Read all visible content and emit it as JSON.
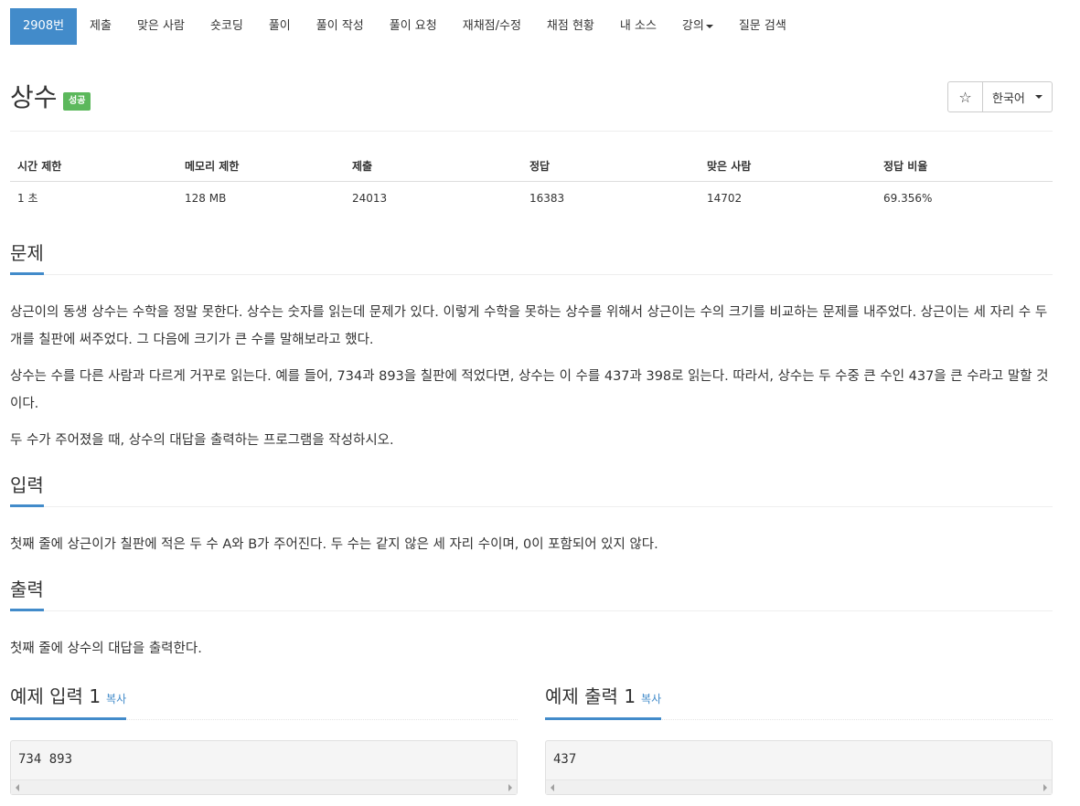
{
  "nav": {
    "items": [
      {
        "label": "2908번",
        "active": true
      },
      {
        "label": "제출"
      },
      {
        "label": "맞은 사람"
      },
      {
        "label": "숏코딩"
      },
      {
        "label": "풀이"
      },
      {
        "label": "풀이 작성"
      },
      {
        "label": "풀이 요청"
      },
      {
        "label": "재채점/수정"
      },
      {
        "label": "채점 현황"
      },
      {
        "label": "내 소스"
      },
      {
        "label": "강의",
        "dropdown": true
      },
      {
        "label": "질문 검색"
      }
    ]
  },
  "problem": {
    "title": "상수",
    "status_badge": "성공",
    "star_icon": "star-outline-icon",
    "language_label": "한국어"
  },
  "info_table": {
    "headers": [
      "시간 제한",
      "메모리 제한",
      "제출",
      "정답",
      "맞은 사람",
      "정답 비율"
    ],
    "row": [
      "1 초",
      "128 MB",
      "24013",
      "16383",
      "14702",
      "69.356%"
    ]
  },
  "sections": {
    "problem": {
      "title": "문제",
      "paragraphs": [
        "상근이의 동생 상수는 수학을 정말 못한다. 상수는 숫자를 읽는데 문제가 있다. 이렇게 수학을 못하는 상수를 위해서 상근이는 수의 크기를 비교하는 문제를 내주었다. 상근이는 세 자리 수 두 개를 칠판에 써주었다. 그 다음에 크기가 큰 수를 말해보라고 했다.",
        "상수는 수를 다른 사람과 다르게 거꾸로 읽는다. 예를 들어, 734과 893을 칠판에 적었다면, 상수는 이 수를 437과 398로 읽는다. 따라서, 상수는 두 수중 큰 수인 437을 큰 수라고 말할 것이다.",
        "두 수가 주어졌을 때, 상수의 대답을 출력하는 프로그램을 작성하시오."
      ]
    },
    "input": {
      "title": "입력",
      "text": "첫째 줄에 상근이가 칠판에 적은 두 수 A와 B가 주어진다. 두 수는 같지 않은 세 자리 수이며, 0이 포함되어 있지 않다."
    },
    "output": {
      "title": "출력",
      "text": "첫째 줄에 상수의 대답을 출력한다."
    }
  },
  "samples": {
    "input": {
      "title": "예제 입력 1",
      "copy_label": "복사",
      "content": "734 893"
    },
    "output": {
      "title": "예제 출력 1",
      "copy_label": "복사",
      "content": "437"
    }
  },
  "colors": {
    "accent": "#428bca",
    "success": "#5cb85c"
  }
}
